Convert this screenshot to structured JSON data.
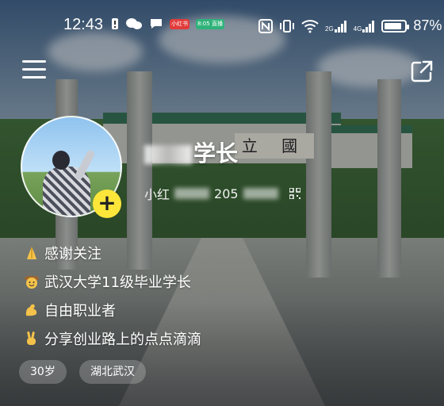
{
  "status_bar": {
    "time": "12:43",
    "network_2g": "2G",
    "network_4g": "4G",
    "battery_percent": "87%",
    "battery_level": 0.87,
    "notification_badges": [
      "小红书",
      "8:05 直播"
    ]
  },
  "header": {
    "menu_icon": "hamburger-menu-icon",
    "share_icon": "share-external-icon"
  },
  "gate_plaque": "立 國",
  "profile": {
    "name": "学长",
    "id_prefix": "小红",
    "id_fragment": "205"
  },
  "bio": [
    {
      "icon": "folded-hands-emoji",
      "text": "感谢关注"
    },
    {
      "icon": "cowboy-hat-face-emoji",
      "text": "武汉大学11级毕业学长"
    },
    {
      "icon": "flexed-biceps-emoji",
      "text": "自由职业者"
    },
    {
      "icon": "victory-hand-emoji",
      "text": "分享创业路上的点点滴滴"
    }
  ],
  "tags": [
    "30岁",
    "湖北武汉"
  ],
  "colors": {
    "follow_button": "#fde63a",
    "text": "#ffffff",
    "tag_bg": "rgba(255,255,255,0.22)"
  }
}
